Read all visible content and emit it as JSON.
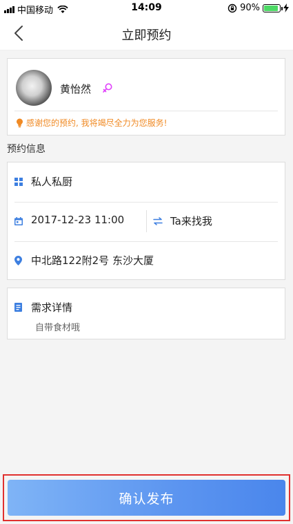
{
  "status_bar": {
    "carrier": "中国移动",
    "time": "14:09",
    "battery": "90%",
    "battery_level": 0.9,
    "icons": [
      "signal-icon",
      "wifi-icon",
      "rotation-lock-icon",
      "battery-icon",
      "charging-icon"
    ]
  },
  "nav": {
    "title": "立即预约",
    "back_icon": "back-arrow-icon"
  },
  "profile": {
    "name": "黄怡然",
    "gender_icon": "female-icon",
    "message": "感谢您的预约, 我将竭尽全力为您服务!"
  },
  "section_label": "预约信息",
  "info": {
    "service": "私人私厨",
    "datetime": "2017-12-23 11:00",
    "mode": "Ta来找我",
    "address": "中北路122附2号 东沙大厦"
  },
  "demand": {
    "title": "需求详情",
    "text": "自带食材哦"
  },
  "confirm_label": "确认发布",
  "colors": {
    "accent": "#4a86ec",
    "icon_blue": "#3d7fe0",
    "warning_orange": "#f08a24",
    "female_pink": "#e040fb",
    "highlight_border": "#e0302e"
  }
}
